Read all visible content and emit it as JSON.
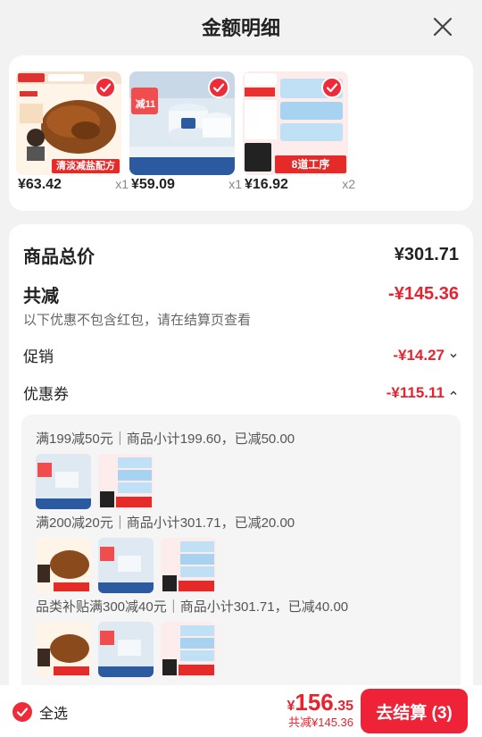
{
  "header": {
    "title": "金额明细",
    "close_icon": "close-icon"
  },
  "products": [
    {
      "price": "¥63.42",
      "qty": "x1",
      "image": "braised-beef-package",
      "badge_text": "清淡减盐配方"
    },
    {
      "price": "¥59.09",
      "qty": "x1",
      "image": "moisturizer-jars",
      "badge_text": "减11"
    },
    {
      "price": "¥16.92",
      "qty": "x2",
      "image": "tissue-packs",
      "badge_text": "8道工序"
    }
  ],
  "summary": {
    "goods_total_label": "商品总价",
    "goods_total_value": "¥301.71",
    "total_discount_label": "共减",
    "total_discount_value": "-¥145.36",
    "note": "以下优惠不包含红包，请在结算页查看",
    "promo_label": "促销",
    "promo_value": "-¥14.27",
    "coupon_label": "优惠券",
    "coupon_value": "-¥115.11"
  },
  "coupons": [
    {
      "text": "满199减50元｜商品小计199.60，已减50.00"
    },
    {
      "text": "满200减20元｜商品小计301.71，已减20.00"
    },
    {
      "text": "品类补贴满300减40元｜商品小计301.71，已减40.00"
    }
  ],
  "footer": {
    "select_all": "全选",
    "total_currency": "¥",
    "total_int": "156",
    "total_dec": ".35",
    "total_saved": "共减¥145.36",
    "checkout": "去结算 (3)"
  },
  "colors": {
    "accent_red": "#e8232f",
    "button_red": "#ef2337"
  }
}
